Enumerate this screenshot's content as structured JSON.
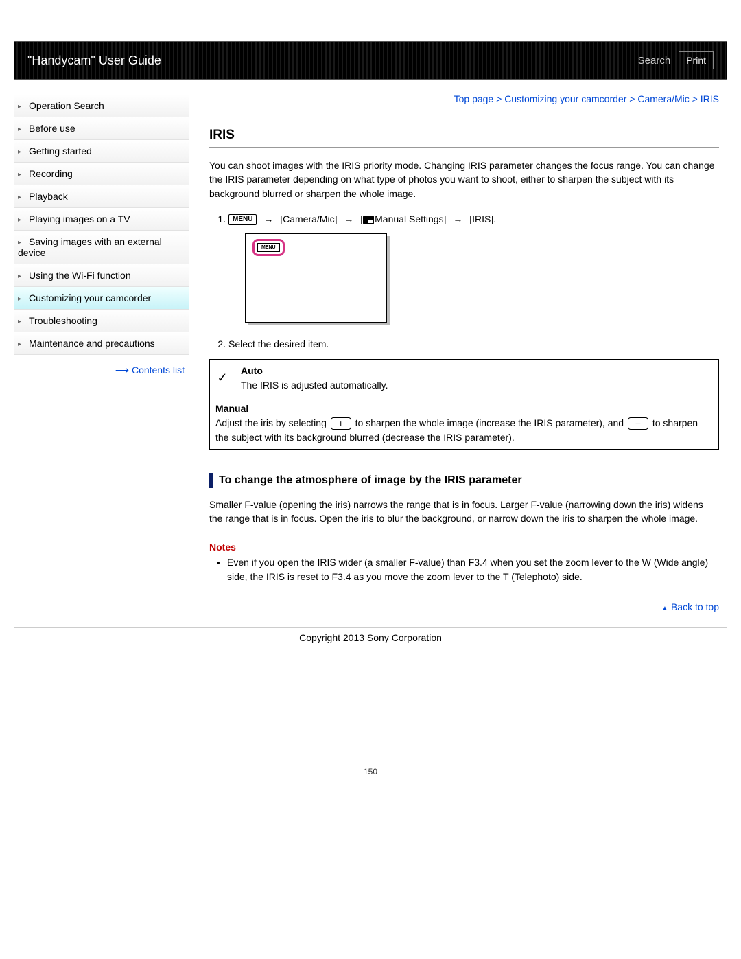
{
  "header": {
    "title": "\"Handycam\" User Guide",
    "search_label": "Search",
    "print_label": "Print"
  },
  "sidebar": {
    "items": [
      {
        "label": "Operation Search",
        "active": false
      },
      {
        "label": "Before use",
        "active": false
      },
      {
        "label": "Getting started",
        "active": false
      },
      {
        "label": "Recording",
        "active": false
      },
      {
        "label": "Playback",
        "active": false
      },
      {
        "label": "Playing images on a TV",
        "active": false
      },
      {
        "label": "Saving images with an external device",
        "active": false
      },
      {
        "label": "Using the Wi-Fi function",
        "active": false
      },
      {
        "label": "Customizing your camcorder",
        "active": true
      },
      {
        "label": "Troubleshooting",
        "active": false
      },
      {
        "label": "Maintenance and precautions",
        "active": false
      }
    ],
    "contents_list": "Contents list"
  },
  "breadcrumb": {
    "top": "Top page",
    "cat": "Customizing your camcorder",
    "sub": "Camera/Mic",
    "leaf": "IRIS",
    "sep": " > "
  },
  "content": {
    "title": "IRIS",
    "intro": "You can shoot images with the IRIS priority mode. Changing IRIS parameter changes the focus range. You can change the IRIS parameter depending on what type of photos you want to shoot, either to sharpen the subject with its background blurred or sharpen the whole image.",
    "step1": {
      "menu_badge": "MENU",
      "path1": "[Camera/Mic]",
      "path2_prefix": "[",
      "path2": "Manual Settings]",
      "path3": "[IRIS]."
    },
    "step2": "Select the desired item.",
    "illustration_menu_badge": "MENU",
    "options": {
      "auto": {
        "title": "Auto",
        "desc": "The IRIS is adjusted automatically."
      },
      "manual": {
        "title": "Manual",
        "desc_pre": "Adjust the iris by selecting ",
        "desc_mid": " to sharpen the whole image (increase the IRIS parameter), and ",
        "desc_post": " to sharpen the subject with its background blurred (decrease the IRIS parameter)."
      }
    },
    "sub_heading": "To change the atmosphere of image by the IRIS parameter",
    "sub_para": "Smaller F-value (opening the iris) narrows the range that is in focus. Larger F-value (narrowing down the iris) widens the range that is in focus. Open the iris to blur the background, or narrow down the iris to sharpen the whole image.",
    "notes_head": "Notes",
    "note1": "Even if you open the IRIS wider (a smaller F-value) than F3.4 when you set the zoom lever to the W (Wide angle) side, the IRIS is reset to F3.4 as you move the zoom lever to the T (Telephoto) side.",
    "back_to_top": "Back to top",
    "copyright": "Copyright 2013 Sony Corporation",
    "page_number": "150"
  }
}
